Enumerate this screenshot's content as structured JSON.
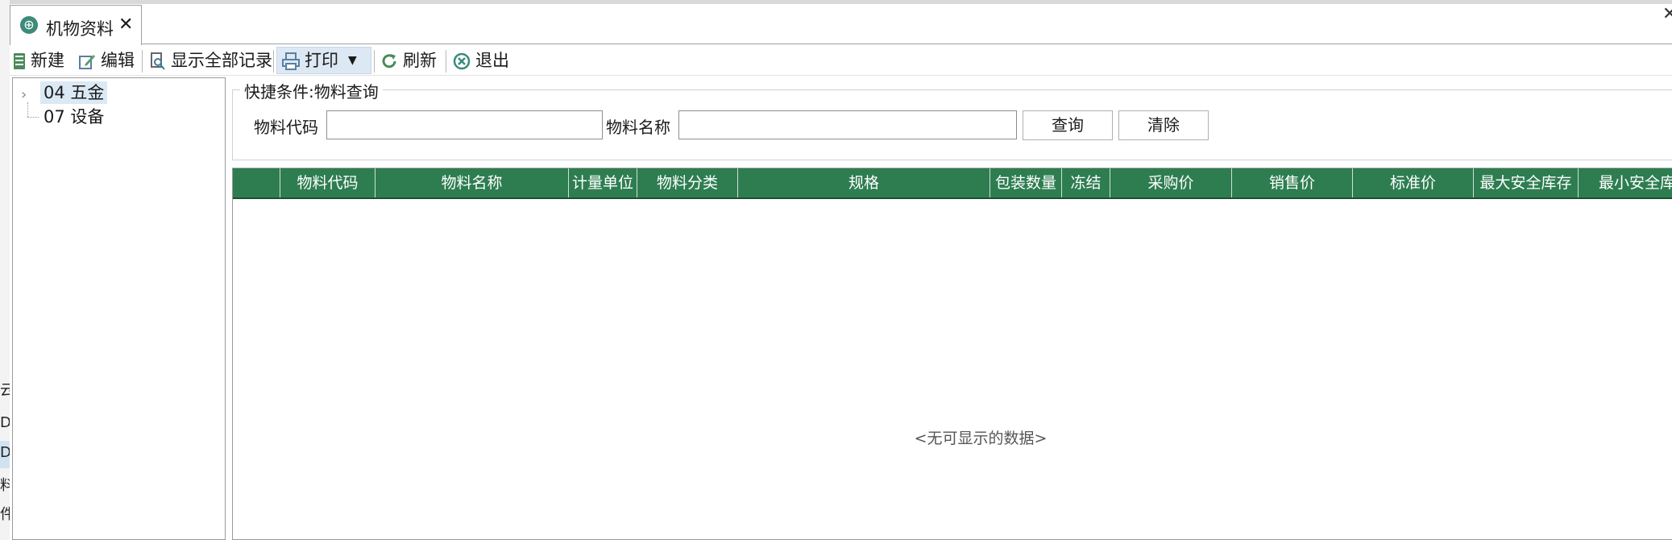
{
  "window": {
    "tab_title": "机物资料",
    "tab_close": "✕",
    "window_close": "✕",
    "tab_icon": "globe-icon"
  },
  "toolbar": {
    "new_label": "新建",
    "edit_label": "编辑",
    "show_all_label": "显示全部记录",
    "print_label": "打印",
    "refresh_label": "刷新",
    "exit_label": "退出"
  },
  "tree": {
    "items": [
      {
        "label": "04 五金",
        "selected": true,
        "expandable": true
      },
      {
        "label": "07 设备",
        "selected": false,
        "expandable": false
      }
    ]
  },
  "search": {
    "legend": "快捷条件:物料查询",
    "code_label": "物料代码",
    "code_value": "",
    "name_label": "物料名称",
    "name_value": "",
    "query_button": "查询",
    "clear_button": "清除"
  },
  "grid": {
    "columns": [
      "",
      "物料代码",
      "物料名称",
      "计量单位",
      "物料分类",
      "规格",
      "包装数量",
      "冻结",
      "采购价",
      "销售价",
      "标准价",
      "最大安全库存",
      "最小安全库"
    ],
    "rows": [],
    "empty_text": "<无可显示的数据>",
    "header_color": "#2e7d51"
  },
  "background_window": {
    "glyphs": [
      "云",
      "D",
      "D",
      "料",
      "件"
    ]
  }
}
